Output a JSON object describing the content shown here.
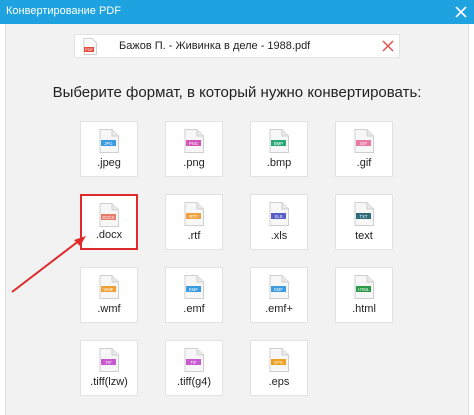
{
  "window": {
    "title": "Конвертирование PDF"
  },
  "file": {
    "name": "Бажов П. - Живинка в деле - 1988.pdf",
    "badge": "PDF"
  },
  "heading": "Выберите формат, в который нужно конвертировать:",
  "formats": [
    {
      "ext": ".jpeg",
      "badge": "JPG",
      "color": "#3b9be0"
    },
    {
      "ext": ".png",
      "badge": "PNG",
      "color": "#d455b8"
    },
    {
      "ext": ".bmp",
      "badge": "BMP",
      "color": "#2aa876"
    },
    {
      "ext": ".gif",
      "badge": "GIF",
      "color": "#e87aa8"
    },
    {
      "ext": ".docx",
      "badge": "DOCX",
      "color": "#e87a6a",
      "selected": true
    },
    {
      "ext": ".rtf",
      "badge": "RTF",
      "color": "#f0a040"
    },
    {
      "ext": ".xls",
      "badge": "XLS",
      "color": "#5a5fc8"
    },
    {
      "ext": "text",
      "badge": "TXT",
      "color": "#2f6b7a"
    },
    {
      "ext": ".wmf",
      "badge": "WMF",
      "color": "#f0a030"
    },
    {
      "ext": ".emf",
      "badge": "EMF",
      "color": "#3b9be0"
    },
    {
      "ext": ".emf+",
      "badge": "EMF",
      "color": "#3b9be0"
    },
    {
      "ext": ".html",
      "badge": "HTML",
      "color": "#2a9a4a"
    },
    {
      "ext": ".tiff(lzw)",
      "badge": "TIF",
      "color": "#c85ad0"
    },
    {
      "ext": ".tiff(g4)",
      "badge": "TIF",
      "color": "#c85ad0"
    },
    {
      "ext": ".eps",
      "badge": "EPS",
      "color": "#f0a020"
    }
  ],
  "colors": {
    "titlebar": "#1fa3e0",
    "panel": "#f2f2f2",
    "selection": "#e02a2a",
    "remove": "#e05050"
  },
  "icons": [
    "close-icon",
    "pdf-file-icon",
    "remove-file-icon",
    "file-format-icon",
    "pointer-arrow"
  ]
}
